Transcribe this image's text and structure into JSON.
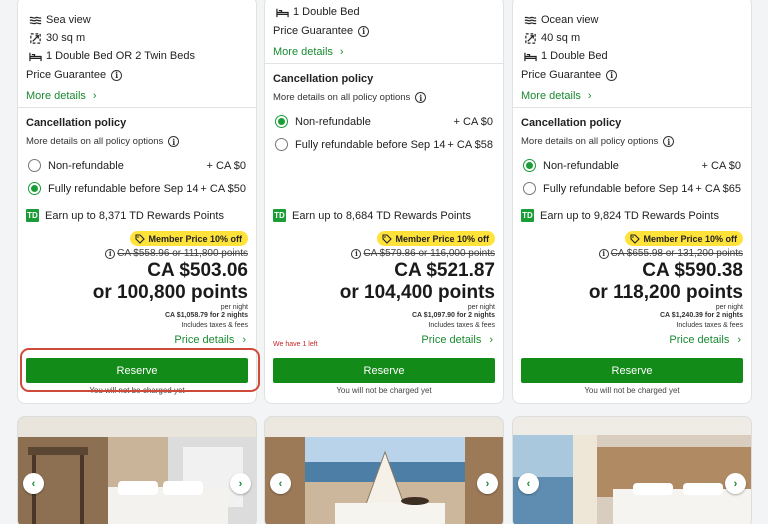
{
  "rooms": [
    {
      "features": [
        {
          "icon": "sea-view-icon",
          "text": "Sea view"
        },
        {
          "icon": "area-icon",
          "text": "30 sq m"
        },
        {
          "icon": "bed-icon",
          "text": "1 Double Bed OR 2 Twin Beds"
        }
      ],
      "price_guarantee": "Price Guarantee",
      "more_details": "More details",
      "cancellation_title": "Cancellation policy",
      "cancellation_sub": "More details on all policy options",
      "options": [
        {
          "label": "Non-refundable",
          "price": "+ CA $0",
          "selected": false
        },
        {
          "label": "Fully refundable before Sep 14",
          "price": "+ CA $50",
          "selected": true
        }
      ],
      "rewards": "Earn up to 8,371 TD Rewards Points",
      "member_badge": "Member Price 10% off",
      "original_price": "CA $558.96 or 111,800 points",
      "price": "CA $503.06",
      "points": "or 100,800 points",
      "per_night": "per night",
      "total": "CA $1,058.79 for 2 nights",
      "taxes": "Includes taxes & fees",
      "scarcity": "",
      "price_details": "Price details",
      "reserve": "Reserve",
      "no_charge": "You will not be charged yet"
    },
    {
      "features": [
        {
          "icon": "bed-icon",
          "text": "1 Double Bed"
        }
      ],
      "price_guarantee": "Price Guarantee",
      "more_details": "More details",
      "cancellation_title": "Cancellation policy",
      "cancellation_sub": "More details on all policy options",
      "options": [
        {
          "label": "Non-refundable",
          "price": "+ CA $0",
          "selected": true
        },
        {
          "label": "Fully refundable before Sep 14",
          "price": "+ CA $58",
          "selected": false
        }
      ],
      "rewards": "Earn up to 8,684 TD Rewards Points",
      "member_badge": "Member Price 10% off",
      "original_price": "CA $579.86 or 116,000 points",
      "price": "CA $521.87",
      "points": "or 104,400 points",
      "per_night": "per night",
      "total": "CA $1,097.90 for 2 nights",
      "taxes": "Includes taxes & fees",
      "scarcity": "We have 1 left",
      "price_details": "Price details",
      "reserve": "Reserve",
      "no_charge": "You will not be charged yet"
    },
    {
      "features": [
        {
          "icon": "sea-view-icon",
          "text": "Ocean view"
        },
        {
          "icon": "area-icon",
          "text": "40 sq m"
        },
        {
          "icon": "bed-icon",
          "text": "1 Double Bed"
        }
      ],
      "price_guarantee": "Price Guarantee",
      "more_details": "More details",
      "cancellation_title": "Cancellation policy",
      "cancellation_sub": "More details on all policy options",
      "options": [
        {
          "label": "Non-refundable",
          "price": "+ CA $0",
          "selected": true
        },
        {
          "label": "Fully refundable before Sep 14",
          "price": "+ CA $65",
          "selected": false
        }
      ],
      "rewards": "Earn up to 9,824 TD Rewards Points",
      "member_badge": "Member Price 10% off",
      "original_price": "CA $655.98 or 131,200 points",
      "price": "CA $590.38",
      "points": "or 118,200 points",
      "per_night": "per night",
      "total": "CA $1,240.39 for 2 nights",
      "taxes": "Includes taxes & fees",
      "scarcity": "",
      "price_details": "Price details",
      "reserve": "Reserve",
      "no_charge": "You will not be charged yet"
    }
  ],
  "colors": {
    "accent": "#1a9d37",
    "reserve_button": "#138b18",
    "badge": "#ffe23a",
    "highlight": "#cf4a37",
    "scarcity": "#c62828"
  },
  "icons": {
    "info": "i",
    "chevron_right": "›",
    "chevron_left": "‹",
    "td_logo": "TD"
  }
}
